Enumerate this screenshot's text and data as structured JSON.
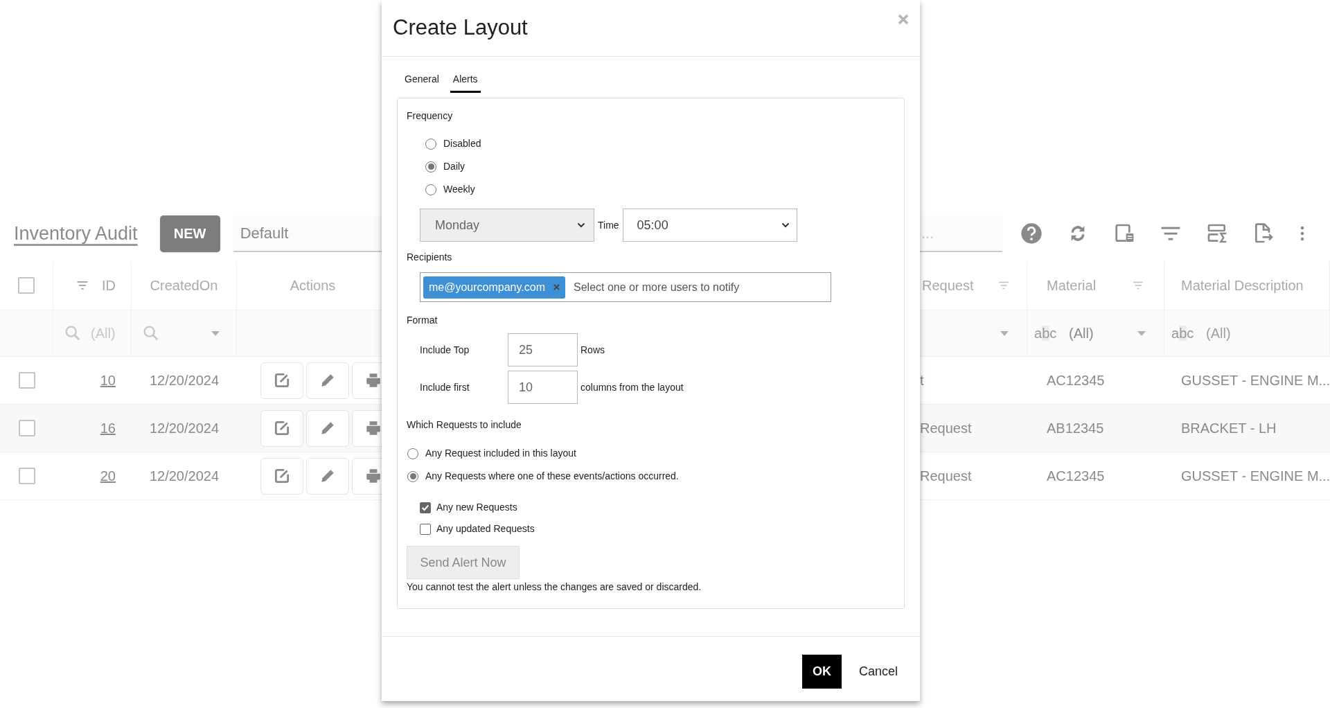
{
  "page": {
    "title": "Inventory Audit",
    "new_button": "NEW",
    "layout_field": {
      "value": "Default"
    },
    "search_field": {
      "placeholder": "..."
    }
  },
  "table": {
    "select_all": {
      "checked": false
    },
    "left_columns": [
      {
        "label": "ID",
        "filter": "(All)"
      },
      {
        "label": "CreatedOn"
      },
      {
        "label": "Actions"
      }
    ],
    "right_columns": [
      {
        "label": "Request"
      },
      {
        "label": "Material",
        "type_hint": "abc",
        "filter": "(All)"
      },
      {
        "label": "Material Description",
        "type_hint": "abc",
        "filter": "(All)"
      }
    ],
    "rows": [
      {
        "checked": false,
        "id": "10",
        "created_on": "12/20/2024",
        "column_5": "t",
        "material": "AC12345",
        "material_description": "GUSSET - ENGINE M..."
      },
      {
        "checked": false,
        "id": "16",
        "created_on": "12/20/2024",
        "column_5": "Request",
        "material": "AB12345",
        "material_description": "BRACKET - LH"
      },
      {
        "checked": false,
        "id": "20",
        "created_on": "12/20/2024",
        "column_5": "Request",
        "material": "AC12345",
        "material_description": "GUSSET - ENGINE M..."
      }
    ]
  },
  "dialog": {
    "title": "Create Layout",
    "tabs": [
      {
        "label": "General",
        "selected": false
      },
      {
        "label": "Alerts",
        "selected": true
      }
    ],
    "frequency": {
      "label": "Frequency",
      "options": [
        {
          "label": "Disabled",
          "selected": false
        },
        {
          "label": "Daily",
          "selected": true
        },
        {
          "label": "Weekly",
          "selected": false
        }
      ]
    },
    "day_select": {
      "value": "Monday",
      "disabled": true
    },
    "time_label": "Time",
    "time_select": {
      "value": "05:00"
    },
    "recipients": {
      "label": "Recipients",
      "tags": [
        "me@yourcompany.com"
      ],
      "placeholder": "Select one or more users to notify"
    },
    "format": {
      "label": "Format",
      "fields": [
        {
          "label": "Include Top",
          "value": "25",
          "suffix": "Rows"
        },
        {
          "label": "Include first",
          "value": "10",
          "suffix": "columns from the layout"
        }
      ]
    },
    "which": {
      "label": "Which Requests to include",
      "options": [
        {
          "label": "Any Request included in this layout",
          "selected": false
        },
        {
          "label": "Any Requests where one of these events/actions occurred.",
          "selected": true
        }
      ]
    },
    "events": [
      {
        "label": "Any new Requests",
        "checked": true
      },
      {
        "label": "Any updated Requests",
        "checked": false
      }
    ],
    "send_button": {
      "label": "Send Alert Now",
      "disabled": true
    },
    "note": "You cannot test the alert unless the changes are saved or discarded.",
    "buttons": {
      "ok": "OK",
      "cancel": "Cancel"
    }
  }
}
